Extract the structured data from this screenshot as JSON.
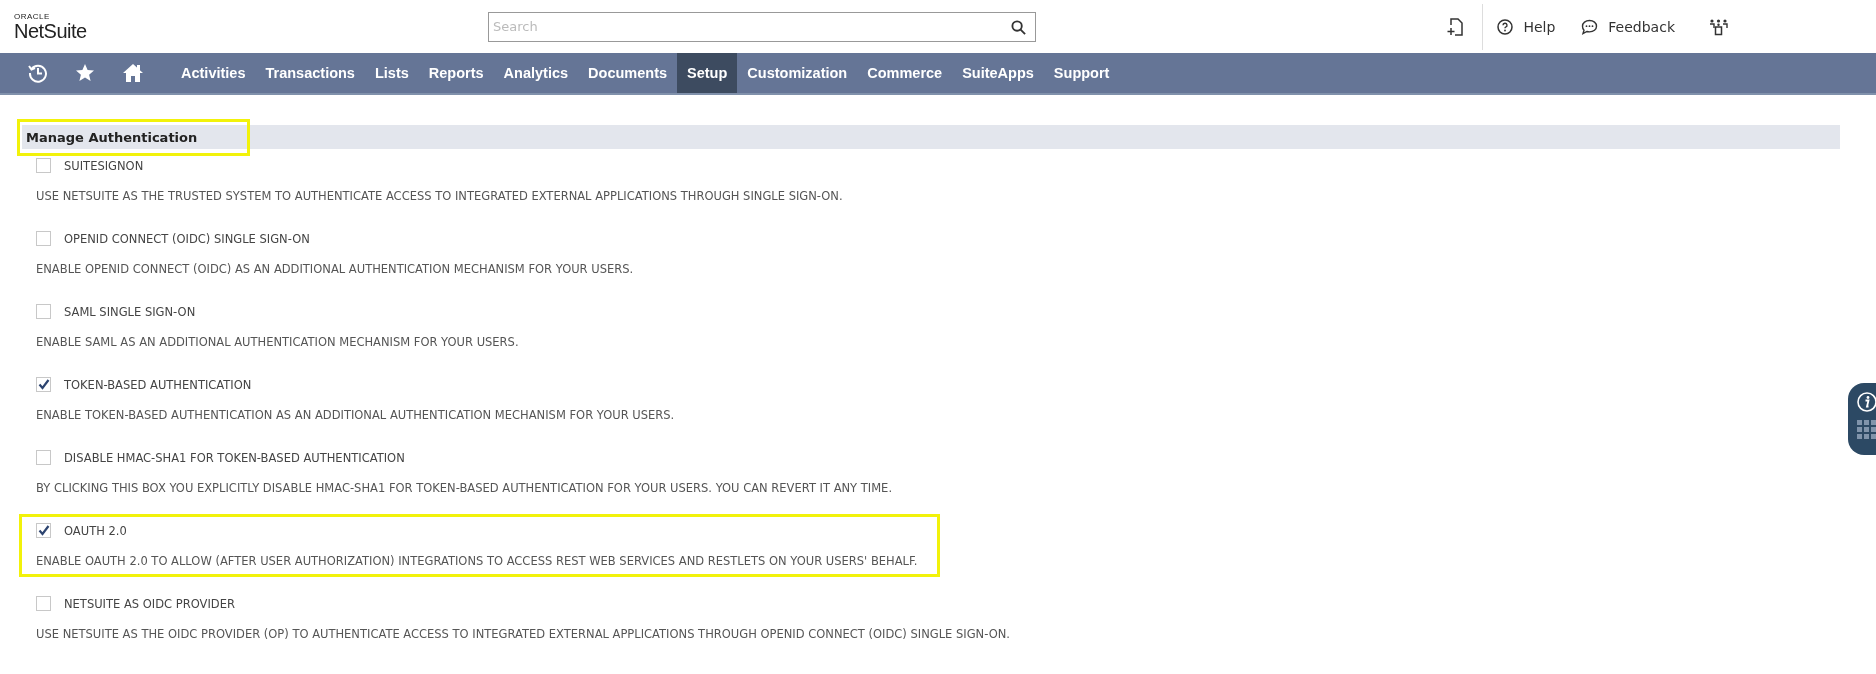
{
  "logo": {
    "brand": "ORACLE",
    "product": "NetSuite"
  },
  "search": {
    "placeholder": "Search"
  },
  "header_links": [
    {
      "kind": "help",
      "label": "Help"
    },
    {
      "kind": "feedback",
      "label": "Feedback"
    }
  ],
  "nav": {
    "items": [
      {
        "label": "Activities",
        "selected": false
      },
      {
        "label": "Transactions",
        "selected": false
      },
      {
        "label": "Lists",
        "selected": false
      },
      {
        "label": "Reports",
        "selected": false
      },
      {
        "label": "Analytics",
        "selected": false
      },
      {
        "label": "Documents",
        "selected": false
      },
      {
        "label": "Setup",
        "selected": true
      },
      {
        "label": "Customization",
        "selected": false
      },
      {
        "label": "Commerce",
        "selected": false
      },
      {
        "label": "SuiteApps",
        "selected": false
      },
      {
        "label": "Support",
        "selected": false
      }
    ]
  },
  "section": {
    "title": "Manage Authentication",
    "highlighted": true
  },
  "options": [
    {
      "label": "SUITESIGNON",
      "checked": false,
      "highlighted": false,
      "description": "USE NETSUITE AS THE TRUSTED SYSTEM TO AUTHENTICATE ACCESS TO INTEGRATED EXTERNAL APPLICATIONS THROUGH SINGLE SIGN-ON."
    },
    {
      "label": "OPENID CONNECT (OIDC) SINGLE SIGN-ON",
      "checked": false,
      "highlighted": false,
      "description": "ENABLE OPENID CONNECT (OIDC) AS AN ADDITIONAL AUTHENTICATION MECHANISM FOR YOUR USERS."
    },
    {
      "label": "SAML SINGLE SIGN-ON",
      "checked": false,
      "highlighted": false,
      "description": "ENABLE SAML AS AN ADDITIONAL AUTHENTICATION MECHANISM FOR YOUR USERS."
    },
    {
      "label": "TOKEN-BASED AUTHENTICATION",
      "checked": true,
      "highlighted": false,
      "description": "ENABLE TOKEN-BASED AUTHENTICATION AS AN ADDITIONAL AUTHENTICATION MECHANISM FOR YOUR USERS."
    },
    {
      "label": "DISABLE HMAC-SHA1 FOR TOKEN-BASED AUTHENTICATION",
      "checked": false,
      "highlighted": false,
      "description": "BY CLICKING THIS BOX YOU EXPLICITLY DISABLE HMAC-SHA1 FOR TOKEN-BASED AUTHENTICATION FOR YOUR USERS. YOU CAN REVERT IT ANY TIME."
    },
    {
      "label": "OAUTH 2.0",
      "checked": true,
      "highlighted": true,
      "description": "ENABLE OAUTH 2.0 TO ALLOW (AFTER USER AUTHORIZATION) INTEGRATIONS TO ACCESS REST WEB SERVICES AND RESTLETS ON YOUR USERS' BEHALF."
    },
    {
      "label": "NETSUITE AS OIDC PROVIDER",
      "checked": false,
      "highlighted": false,
      "description": "USE NETSUITE AS THE OIDC PROVIDER (OP) TO AUTHENTICATE ACCESS TO INTEGRATED EXTERNAL APPLICATIONS THROUGH OPENID CONNECT (OIDC) SINGLE SIGN-ON."
    }
  ]
}
